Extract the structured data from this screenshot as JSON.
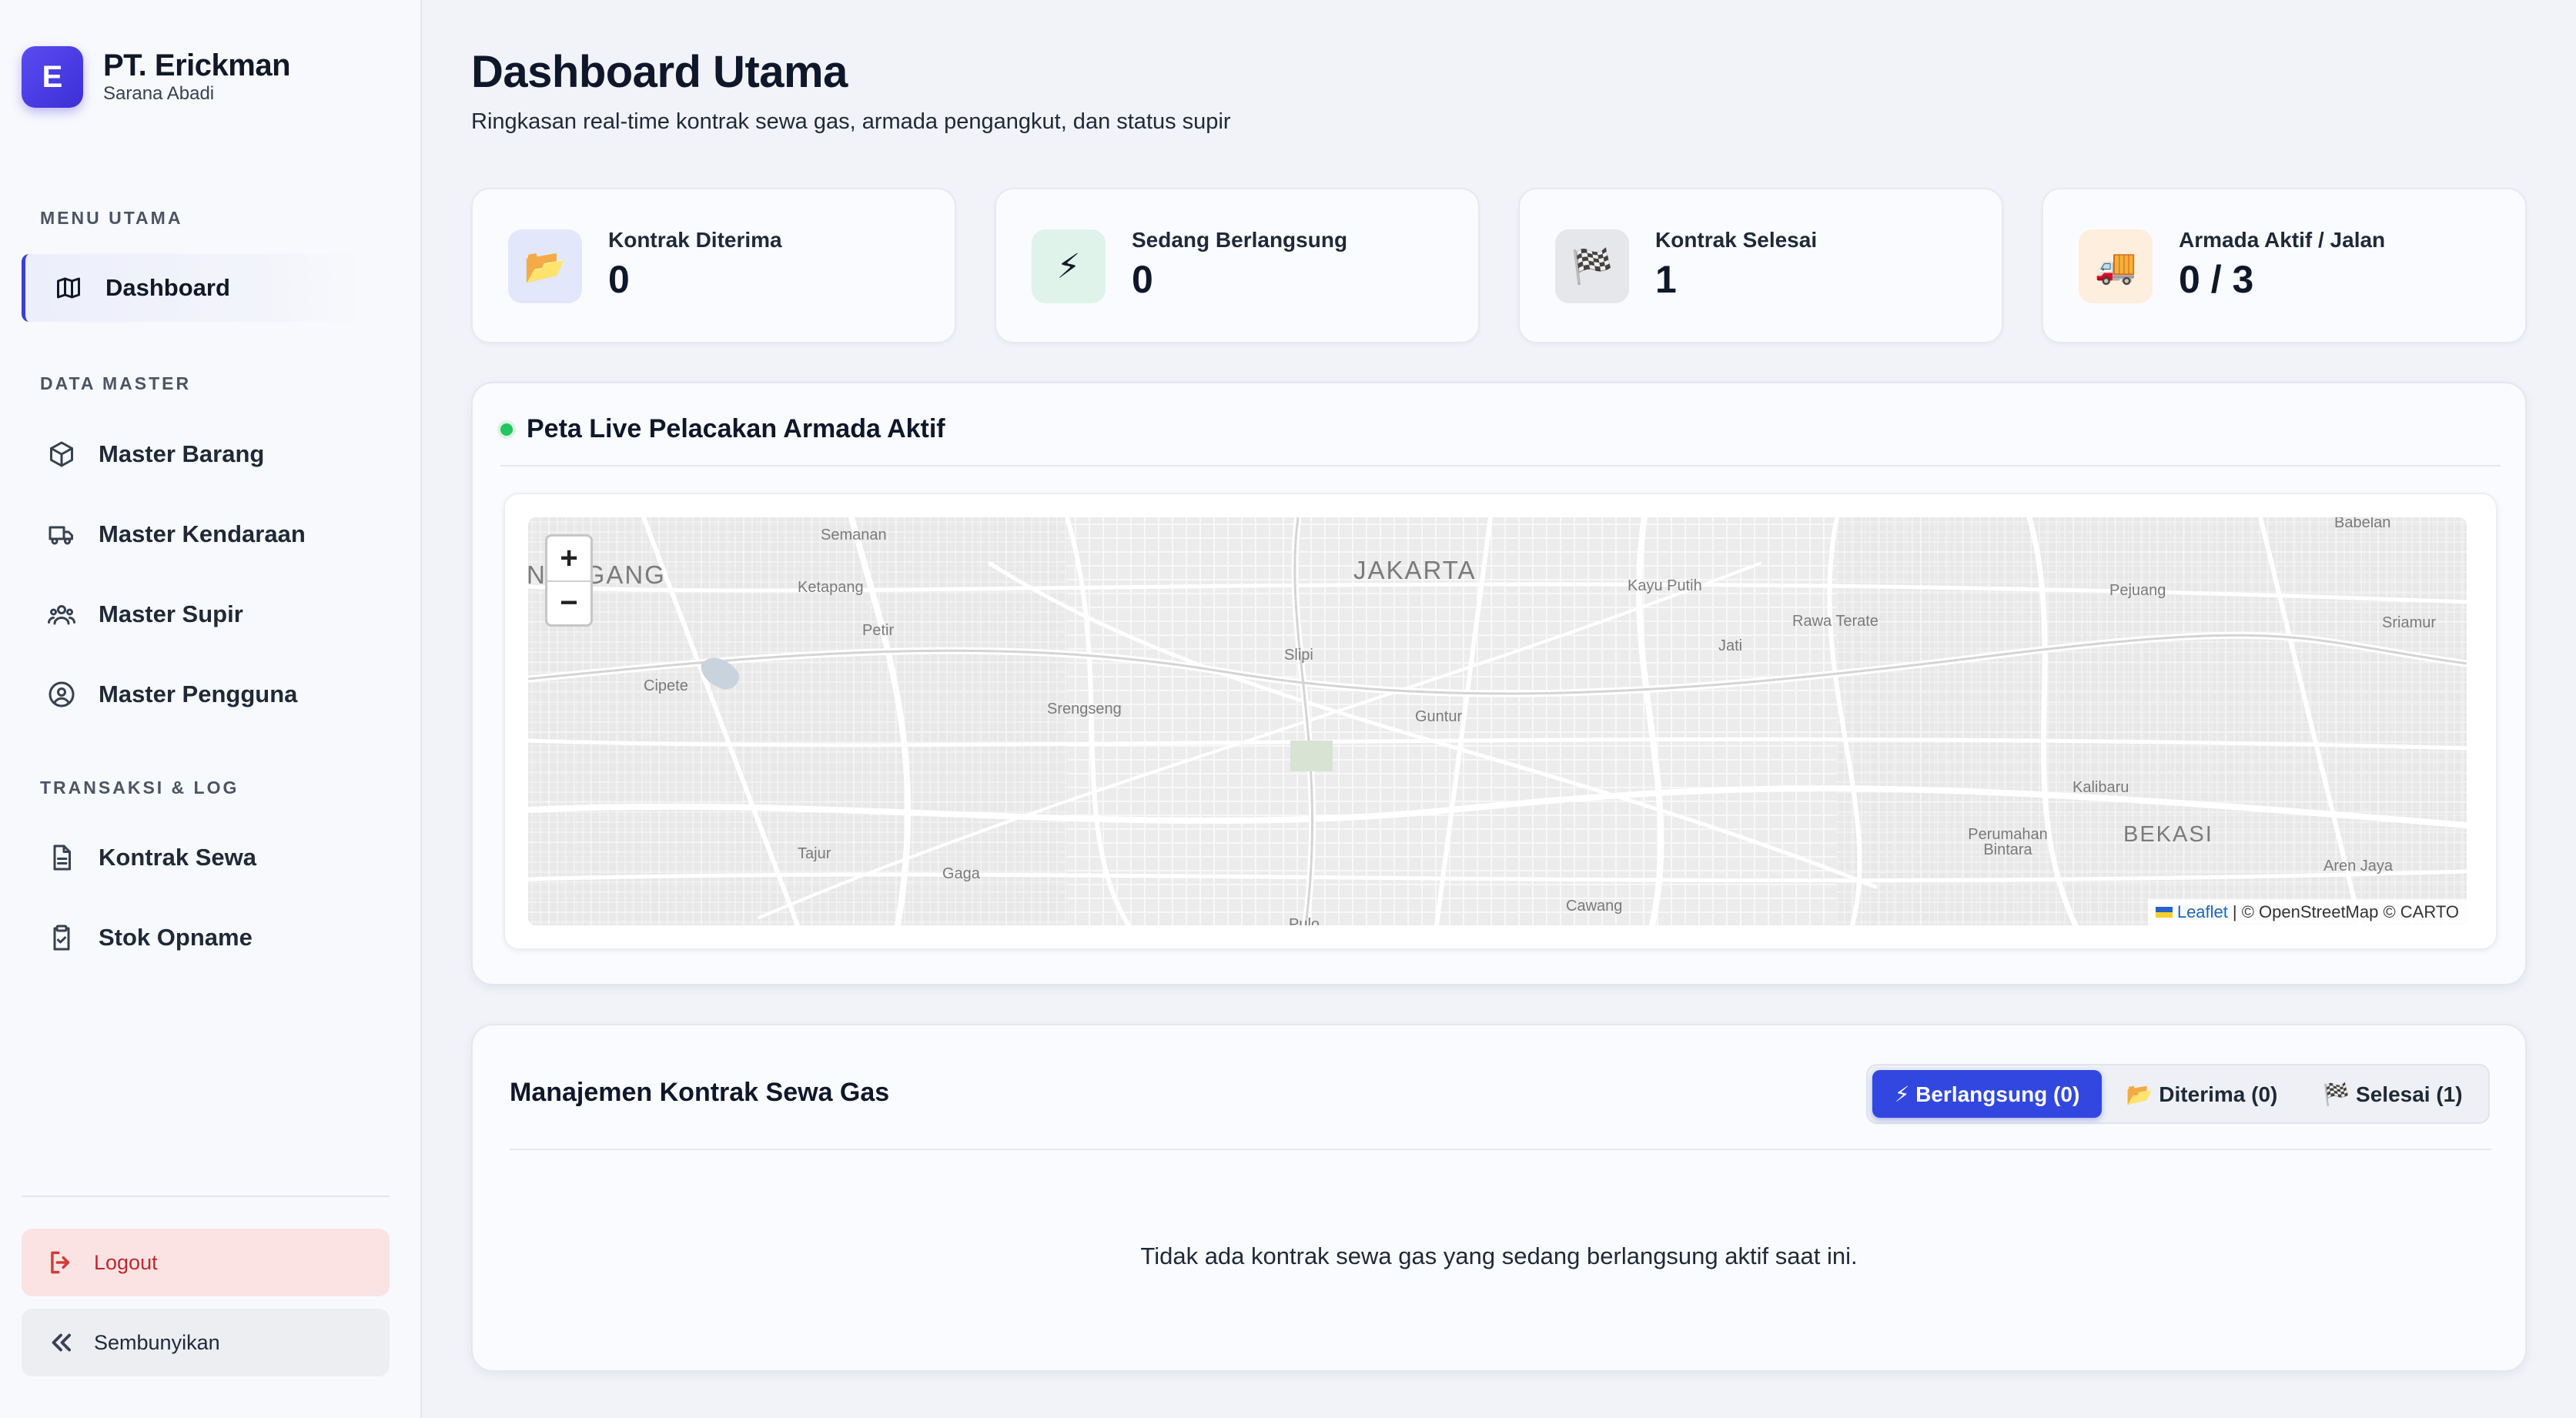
{
  "brand": {
    "initial": "E",
    "name": "PT. Erickman",
    "subtitle": "Sarana Abadi"
  },
  "sidebar": {
    "sections": [
      {
        "title": "MENU UTAMA",
        "items": [
          {
            "label": "Dashboard",
            "icon": "map-icon",
            "active": true
          }
        ]
      },
      {
        "title": "DATA MASTER",
        "items": [
          {
            "label": "Master Barang",
            "icon": "box-icon"
          },
          {
            "label": "Master Kendaraan",
            "icon": "truck-icon"
          },
          {
            "label": "Master Supir",
            "icon": "users-icon"
          },
          {
            "label": "Master Pengguna",
            "icon": "user-circle-icon"
          }
        ]
      },
      {
        "title": "TRANSAKSI & LOG",
        "items": [
          {
            "label": "Kontrak Sewa",
            "icon": "document-icon"
          },
          {
            "label": "Stok Opname",
            "icon": "clipboard-check-icon"
          }
        ]
      }
    ],
    "logout_label": "Logout",
    "hide_label": "Sembunyikan"
  },
  "header": {
    "title": "Dashboard Utama",
    "subtitle": "Ringkasan real-time kontrak sewa gas, armada pengangkut, dan status supir"
  },
  "stats": [
    {
      "label": "Kontrak Diterima",
      "value": "0",
      "icon": "folder-icon",
      "glyph": "📂",
      "bg": "#e2e7fb"
    },
    {
      "label": "Sedang Berlangsung",
      "value": "0",
      "icon": "lightning-icon",
      "glyph": "⚡",
      "bg": "#dff3ea"
    },
    {
      "label": "Kontrak Selesai",
      "value": "1",
      "icon": "checkered-flag-icon",
      "glyph": "🏁",
      "bg": "#e6e7ea"
    },
    {
      "label": "Armada Aktif / Jalan",
      "value": "0 / 3",
      "icon": "truck-icon",
      "glyph": "🚚",
      "bg": "#fdeedd"
    }
  ],
  "map": {
    "title": "Peta Live Pelacakan Armada Aktif",
    "zoom_in": "+",
    "zoom_out": "−",
    "attribution_link": "Leaflet",
    "attribution_text": "| © OpenStreetMap © CARTO",
    "places": {
      "jakarta": "JAKARTA",
      "bekasi": "BEKASI",
      "semanan": "Semanan",
      "ketapang": "Ketapang",
      "petir": "Petir",
      "cipete": "Cipete",
      "srengseng": "Srengseng",
      "slipi": "Slipi",
      "guntur": "Guntur",
      "kayu_putih": "Kayu Putih",
      "rawa_terate": "Rawa Terate",
      "jati": "Jati",
      "pejuang": "Pejuang",
      "babelan": "Babelan",
      "sriamur": "Sriamur",
      "kalibaru": "Kalibaru",
      "perumahan_bintara": "Perumahan Bintara",
      "aren_jaya": "Aren Jaya",
      "tajur": "Tajur",
      "gaga": "Gaga",
      "cawang": "Cawang",
      "pulo": "Pulo",
      "nangang": "NANGANG"
    }
  },
  "contracts": {
    "title": "Manajemen Kontrak Sewa Gas",
    "tabs": [
      {
        "label": "⚡ Berlangsung (0)",
        "active": true
      },
      {
        "label": "📂 Diterima (0)",
        "active": false
      },
      {
        "label": "🏁 Selesai (1)",
        "active": false
      }
    ],
    "empty_message": "Tidak ada kontrak sewa gas yang sedang berlangsung aktif saat ini."
  }
}
